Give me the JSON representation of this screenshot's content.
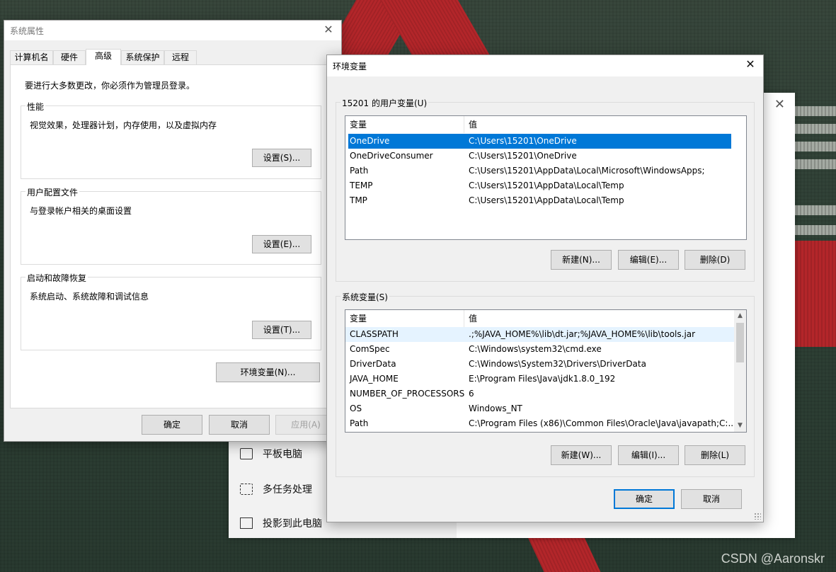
{
  "settings_window": {
    "items": [
      {
        "label": "平板电脑",
        "icon": "tablet-icon"
      },
      {
        "label": "多任务处理",
        "icon": "multitask-icon"
      },
      {
        "label": "投影到此电脑",
        "icon": "project-icon"
      }
    ]
  },
  "system_properties": {
    "title": "系统属性",
    "tabs": [
      "计算机名",
      "硬件",
      "高级",
      "系统保护",
      "远程"
    ],
    "active_tab": "高级",
    "admin_note": "要进行大多数更改，你必须作为管理员登录。",
    "performance": {
      "legend": "性能",
      "desc": "视觉效果，处理器计划，内存使用，以及虚拟内存",
      "button": "设置(S)..."
    },
    "user_profiles": {
      "legend": "用户配置文件",
      "desc": "与登录帐户相关的桌面设置",
      "button": "设置(E)..."
    },
    "startup_recovery": {
      "legend": "启动和故障恢复",
      "desc": "系统启动、系统故障和调试信息",
      "button": "设置(T)..."
    },
    "env_button": "环境变量(N)...",
    "ok": "确定",
    "cancel": "取消",
    "apply": "应用(A)"
  },
  "env_dialog": {
    "title": "环境变量",
    "user_vars": {
      "legend": "15201 的用户变量(U)",
      "columns": [
        "变量",
        "值"
      ],
      "rows": [
        {
          "name": "OneDrive",
          "value": "C:\\Users\\15201\\OneDrive"
        },
        {
          "name": "OneDriveConsumer",
          "value": "C:\\Users\\15201\\OneDrive"
        },
        {
          "name": "Path",
          "value": "C:\\Users\\15201\\AppData\\Local\\Microsoft\\WindowsApps;"
        },
        {
          "name": "TEMP",
          "value": "C:\\Users\\15201\\AppData\\Local\\Temp"
        },
        {
          "name": "TMP",
          "value": "C:\\Users\\15201\\AppData\\Local\\Temp"
        }
      ],
      "selected_row": "OneDrive",
      "buttons": {
        "new": "新建(N)...",
        "edit": "编辑(E)...",
        "delete": "删除(D)"
      }
    },
    "system_vars": {
      "legend": "系统变量(S)",
      "columns": [
        "变量",
        "值"
      ],
      "rows": [
        {
          "name": "CLASSPATH",
          "value": ".;%JAVA_HOME%\\lib\\dt.jar;%JAVA_HOME%\\lib\\tools.jar"
        },
        {
          "name": "ComSpec",
          "value": "C:\\Windows\\system32\\cmd.exe"
        },
        {
          "name": "DriverData",
          "value": "C:\\Windows\\System32\\Drivers\\DriverData"
        },
        {
          "name": "JAVA_HOME",
          "value": "E:\\Program Files\\Java\\jdk1.8.0_192"
        },
        {
          "name": "NUMBER_OF_PROCESSORS",
          "value": "6"
        },
        {
          "name": "OS",
          "value": "Windows_NT"
        },
        {
          "name": "Path",
          "value": "C:\\Program Files (x86)\\Common Files\\Oracle\\Java\\javapath;C:..."
        }
      ],
      "hover_row": "CLASSPATH",
      "buttons": {
        "new": "新建(W)...",
        "edit": "编辑(I)...",
        "delete": "删除(L)"
      }
    },
    "ok": "确定",
    "cancel": "取消"
  },
  "watermark": "CSDN @Aaronskr"
}
